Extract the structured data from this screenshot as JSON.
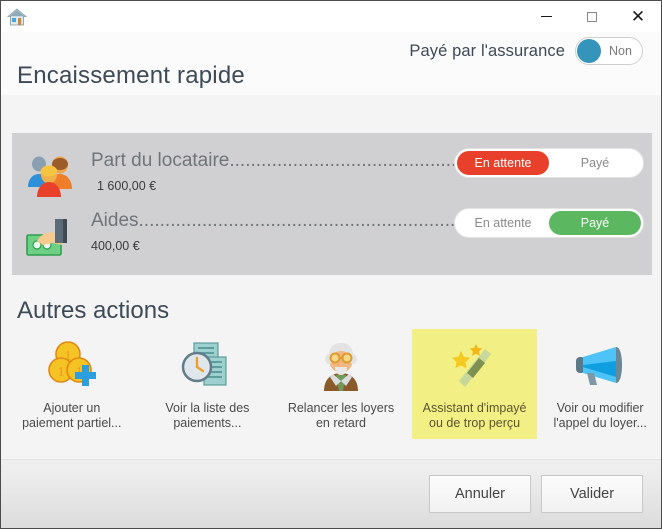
{
  "window": {
    "app_icon": "house-icon",
    "controls": {
      "minimize": "minimize-icon",
      "maximize": "maximize-icon",
      "close": "close-icon"
    }
  },
  "header": {
    "insurance_label": "Payé par l'assurance",
    "insurance_toggle_value": "Non",
    "insurance_toggle_state": "off",
    "title": "Encaissement rapide"
  },
  "payments": {
    "rows": [
      {
        "icon": "family-tenants-icon",
        "label": "Part du locataire.............................................................",
        "amount": "1 600,00 €",
        "options": [
          "En attente",
          "Payé"
        ],
        "selected": "En attente",
        "selected_color": "#e8402a"
      },
      {
        "icon": "hand-money-icon",
        "label": "Aides..............................................................................",
        "amount": "400,00 €",
        "options": [
          "En attente",
          "Payé"
        ],
        "selected": "Payé",
        "selected_color": "#5cb860"
      }
    ]
  },
  "actions": {
    "title": "Autres actions",
    "items": [
      {
        "icon": "coins-plus-icon",
        "label": "Ajouter un\npaiement partiel...",
        "highlighted": false
      },
      {
        "icon": "clock-documents-icon",
        "label": "Voir la liste des\npaiements...",
        "highlighted": false
      },
      {
        "icon": "elderly-man-icon",
        "label": "Relancer les loyers\nen retard",
        "highlighted": false
      },
      {
        "icon": "magic-wand-icon",
        "label": "Assistant d'impayé\nou de trop perçu",
        "highlighted": true
      },
      {
        "icon": "megaphone-icon",
        "label": "Voir ou modifier\nl'appel du loyer...",
        "highlighted": false
      }
    ],
    "highlight_color": "#f2ef84"
  },
  "footer": {
    "cancel_label": "Annuler",
    "validate_label": "Valider"
  }
}
